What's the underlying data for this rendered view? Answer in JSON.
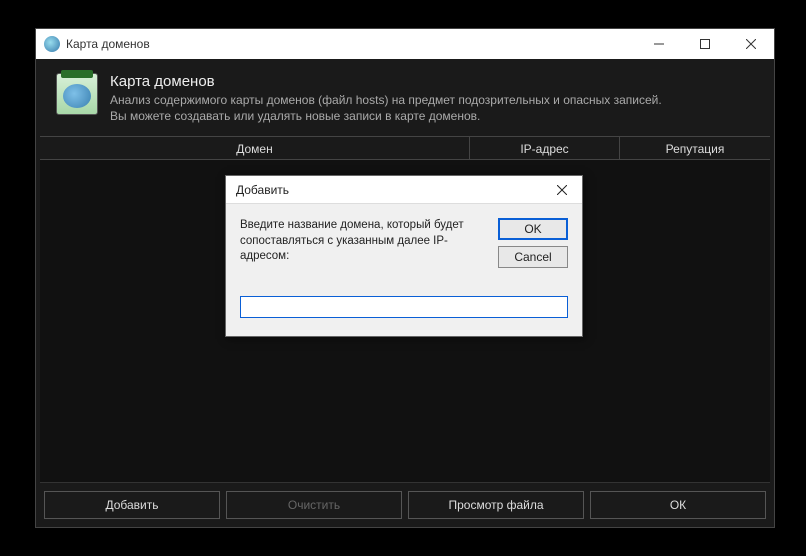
{
  "window": {
    "title": "Карта доменов"
  },
  "header": {
    "title": "Карта доменов",
    "line1": "Анализ содержимого карты доменов (файл hosts) на предмет подозрительных и опасных записей.",
    "line2": "Вы можете создавать или удалять новые записи в карте доменов."
  },
  "columns": {
    "domain": "Домен",
    "ip": "IP-адрес",
    "reputation": "Репутация"
  },
  "footer": {
    "add": "Добавить",
    "clear": "Очистить",
    "view": "Просмотр файла",
    "ok": "ОК"
  },
  "dialog": {
    "title": "Добавить",
    "message": "Введите название домена, который будет сопоставляться с указанным далее IP-адресом:",
    "ok": "OK",
    "cancel": "Cancel",
    "input_value": ""
  }
}
